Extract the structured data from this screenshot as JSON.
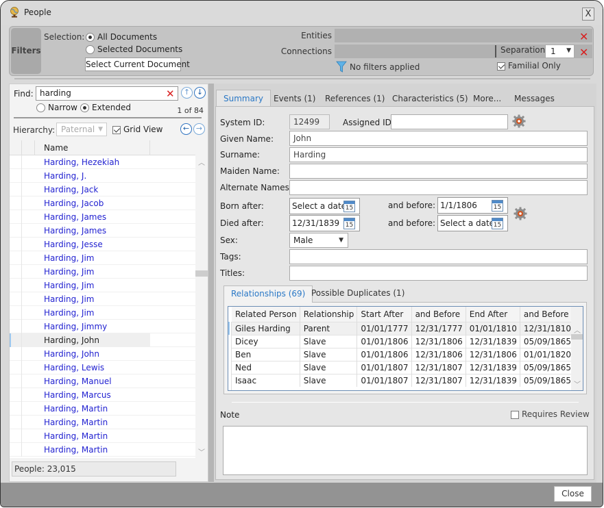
{
  "window": {
    "title": "People",
    "close_glyph": "X"
  },
  "filters": {
    "tab_label": "Filters",
    "selection_label": "Selection:",
    "options": [
      {
        "label": "All Documents",
        "selected": true
      },
      {
        "label": "Selected Documents",
        "selected": false
      }
    ],
    "select_current_label": "Select Current Document",
    "entities_label": "Entities",
    "connections_label": "Connections",
    "separation_label": "Separation:",
    "separation_value": "1",
    "status_text": "No filters applied",
    "familial_only_label": "Familial Only",
    "familial_only_checked": true,
    "clear_glyph": "✕"
  },
  "search": {
    "find_label": "Find:",
    "find_value": "harding",
    "narrow_label": "Narrow",
    "extended_label": "Extended",
    "mode": "Extended",
    "result_count": "1 of 84",
    "hierarchy_label": "Hierarchy:",
    "hierarchy_value": "Paternal",
    "grid_view_label": "Grid View",
    "grid_view_checked": true
  },
  "people_list": {
    "column_header": "Name",
    "rows": [
      {
        "name": "Harding, Hezekiah",
        "selected": false
      },
      {
        "name": "Harding, J.",
        "selected": false
      },
      {
        "name": "Harding, Jack",
        "selected": false
      },
      {
        "name": "Harding, Jacob",
        "selected": false
      },
      {
        "name": "Harding, James",
        "selected": false
      },
      {
        "name": "Harding, James",
        "selected": false
      },
      {
        "name": "Harding, Jesse",
        "selected": false
      },
      {
        "name": "Harding, Jim",
        "selected": false
      },
      {
        "name": "Harding, Jim",
        "selected": false
      },
      {
        "name": "Harding, Jim",
        "selected": false
      },
      {
        "name": "Harding, Jim",
        "selected": false
      },
      {
        "name": "Harding, Jim",
        "selected": false
      },
      {
        "name": "Harding, Jimmy",
        "selected": false
      },
      {
        "name": "Harding, John",
        "selected": true
      },
      {
        "name": "Harding, John",
        "selected": false
      },
      {
        "name": "Harding, Lewis",
        "selected": false
      },
      {
        "name": "Harding, Manuel",
        "selected": false
      },
      {
        "name": "Harding, Marcus",
        "selected": false
      },
      {
        "name": "Harding, Martin",
        "selected": false
      },
      {
        "name": "Harding, Martin",
        "selected": false
      },
      {
        "name": "Harding, Martin",
        "selected": false
      },
      {
        "name": "Harding, Martin",
        "selected": false
      }
    ],
    "footer": "People: 23,015"
  },
  "tabs": [
    {
      "label": "Summary",
      "active": true
    },
    {
      "label": "Events (1)",
      "active": false
    },
    {
      "label": "References (1)",
      "active": false
    },
    {
      "label": "Characteristics (5)",
      "active": false
    },
    {
      "label": "More...",
      "active": false
    },
    {
      "label": "Messages",
      "active": false
    }
  ],
  "summary": {
    "system_id_label": "System ID:",
    "system_id": "12499",
    "assigned_id_label": "Assigned ID:",
    "assigned_id": "",
    "given_name_label": "Given Name:",
    "given_name": "John",
    "surname_label": "Surname:",
    "surname": "Harding",
    "maiden_name_label": "Maiden Name:",
    "maiden_name": "",
    "alternate_names_label": "Alternate Names:",
    "alternate_names": "",
    "born_after_label": "Born after:",
    "born_after": "Select a date",
    "born_before_label": "and before:",
    "born_before": "1/1/1806",
    "died_after_label": "Died after:",
    "died_after": "12/31/1839",
    "died_before_label": "and before:",
    "died_before": "Select a date",
    "calendar_glyph": "15",
    "sex_label": "Sex:",
    "sex": "Male",
    "tags_label": "Tags:",
    "tags": "",
    "titles_label": "Titles:",
    "titles": ""
  },
  "subtabs": [
    {
      "label": "Relationships (69)",
      "active": true
    },
    {
      "label": "Possible Duplicates (1)",
      "active": false
    }
  ],
  "relationships": {
    "columns": [
      "Related Person",
      "Relationship",
      "Start After",
      "and Before",
      "End After",
      "and Before"
    ],
    "rows": [
      [
        "Giles Harding",
        "Parent",
        "01/01/1777",
        "12/31/1777",
        "01/01/1810",
        "12/31/1810"
      ],
      [
        "Dicey",
        "Slave",
        "01/01/1806",
        "12/31/1806",
        "12/31/1839",
        "05/09/1865"
      ],
      [
        "Ben",
        "Slave",
        "01/01/1806",
        "12/31/1806",
        "12/31/1806",
        "01/01/1820"
      ],
      [
        "Ned",
        "Slave",
        "01/01/1807",
        "12/31/1807",
        "12/31/1839",
        "05/09/1865"
      ],
      [
        "Isaac",
        "Slave",
        "01/01/1807",
        "12/31/1807",
        "12/31/1839",
        "05/09/1865"
      ]
    ]
  },
  "note": {
    "label": "Note",
    "value": "",
    "requires_review_label": "Requires Review",
    "requires_review_checked": false
  },
  "footer": {
    "close_label": "Close"
  },
  "colors": {
    "link_blue": "#1f1fd0",
    "active_tab_blue": "#2a78c6",
    "clear_red": "#d81e1e"
  }
}
